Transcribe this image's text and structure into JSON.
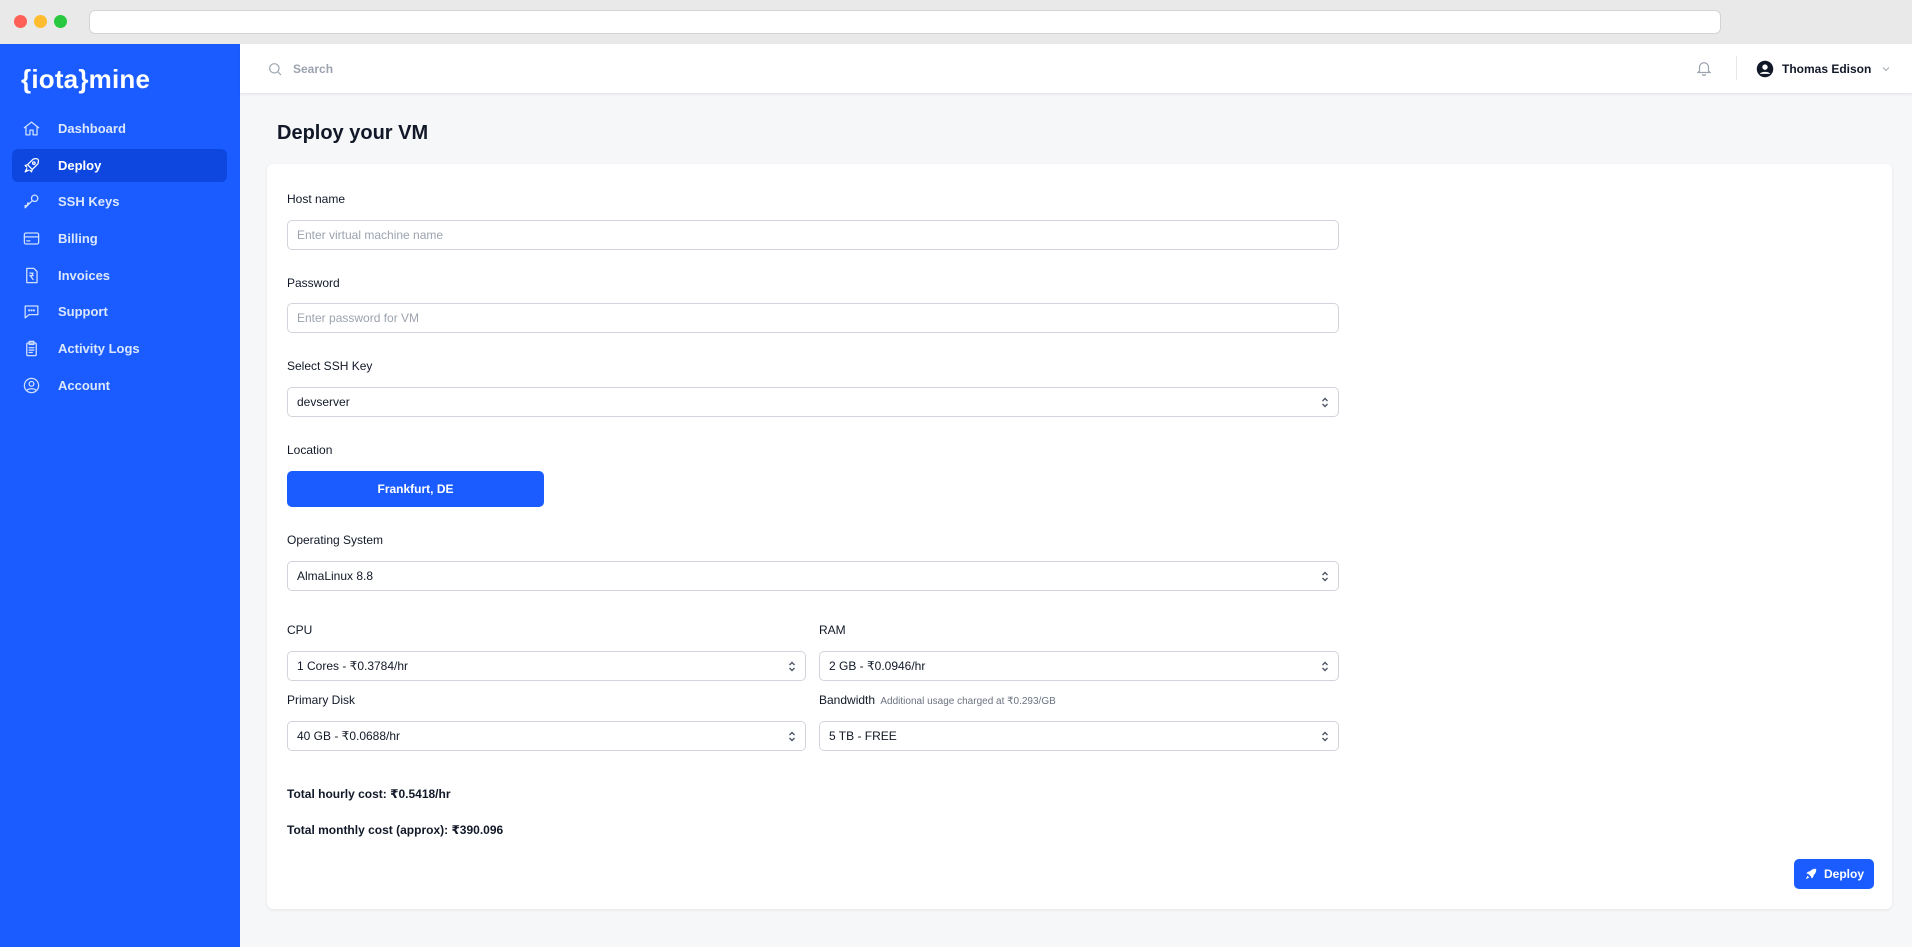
{
  "brand": {
    "name": "{iota}mine"
  },
  "sidebar": {
    "items": [
      {
        "label": "Dashboard",
        "icon": "home-icon",
        "active": false
      },
      {
        "label": "Deploy",
        "icon": "rocket-icon",
        "active": true
      },
      {
        "label": "SSH Keys",
        "icon": "key-icon",
        "active": false
      },
      {
        "label": "Billing",
        "icon": "credit-card-icon",
        "active": false
      },
      {
        "label": "Invoices",
        "icon": "receipt-icon",
        "active": false
      },
      {
        "label": "Support",
        "icon": "chat-bubble-icon",
        "active": false
      },
      {
        "label": "Activity Logs",
        "icon": "clipboard-icon",
        "active": false
      },
      {
        "label": "Account",
        "icon": "user-circle-icon",
        "active": false
      }
    ]
  },
  "topbar": {
    "search_placeholder": "Search",
    "user_name": "Thomas Edison"
  },
  "page": {
    "title": "Deploy your VM"
  },
  "form": {
    "hostname": {
      "label": "Host name",
      "placeholder": "Enter virtual machine name",
      "value": ""
    },
    "password": {
      "label": "Password",
      "placeholder": "Enter password for VM",
      "value": ""
    },
    "ssh_key": {
      "label": "Select SSH Key",
      "value": "devserver"
    },
    "location": {
      "label": "Location",
      "selected": "Frankfurt, DE"
    },
    "os": {
      "label": "Operating System",
      "value": "AlmaLinux 8.8"
    },
    "cpu": {
      "label": "CPU",
      "value": "1 Cores - ₹0.3784/hr"
    },
    "ram": {
      "label": "RAM",
      "value": "2 GB - ₹0.0946/hr"
    },
    "disk": {
      "label": "Primary Disk",
      "value": "40 GB - ₹0.0688/hr"
    },
    "bandwidth": {
      "label": "Bandwidth",
      "note": "Additional usage charged at ₹0.293/GB",
      "value": "5 TB - FREE"
    }
  },
  "totals": {
    "hourly": "Total hourly cost: ₹0.5418/hr",
    "monthly": "Total monthly cost (approx): ₹390.096"
  },
  "actions": {
    "deploy_label": "Deploy"
  },
  "colors": {
    "primary": "#1a5cff",
    "sidebar_active": "#0d47e0",
    "page_bg": "#f6f7f9"
  }
}
